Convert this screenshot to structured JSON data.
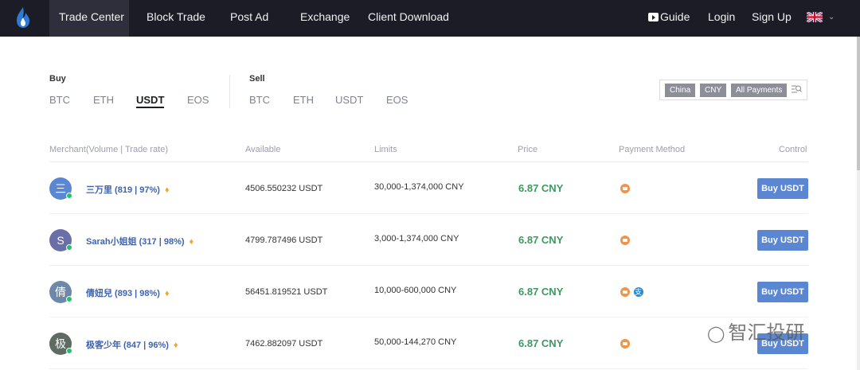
{
  "nav": {
    "logo": "flame-logo",
    "left": [
      "Trade Center",
      "Block Trade",
      "Post Ad",
      "Exchange",
      "Client Download"
    ],
    "guide": "Guide",
    "login": "Login",
    "signup": "Sign Up",
    "language": "uk-flag"
  },
  "buy": {
    "label": "Buy",
    "coins": [
      "BTC",
      "ETH",
      "USDT",
      "EOS"
    ],
    "selected": "USDT"
  },
  "sell": {
    "label": "Sell",
    "coins": [
      "BTC",
      "ETH",
      "USDT",
      "EOS"
    ]
  },
  "filters": {
    "country": "China",
    "currency": "CNY",
    "payment": "All Payments",
    "icon": "search-icon"
  },
  "table": {
    "headers": [
      "Merchant(Volume | Trade rate)",
      "Available",
      "Limits",
      "Price",
      "Payment Method",
      "Control"
    ],
    "rows": [
      {
        "avatar": "三",
        "avatar_color": "#5b86d1",
        "merchant": "三万里 (819 | 97%)",
        "available": "4506.550232 USDT",
        "limits": "30,000-1,374,000 CNY",
        "price": "6.87 CNY",
        "payments": [
          "bank"
        ],
        "button": "Buy USDT"
      },
      {
        "avatar": "S",
        "avatar_color": "#6b6fa8",
        "merchant": "Sarah小姐姐 (317 | 98%)",
        "available": "4799.787496 USDT",
        "limits": "3,000-1,374,000 CNY",
        "price": "6.87 CNY",
        "payments": [
          "bank"
        ],
        "button": "Buy USDT"
      },
      {
        "avatar": "倩",
        "avatar_color": "#6d88a9",
        "merchant": "倩妞兒 (893 | 98%)",
        "available": "56451.819521 USDT",
        "limits": "10,000-600,000 CNY",
        "price": "6.87 CNY",
        "payments": [
          "bank",
          "alipay"
        ],
        "button": "Buy USDT"
      },
      {
        "avatar": "极",
        "avatar_color": "#5d6b63",
        "merchant": "极客少年 (847 | 96%)",
        "available": "7462.882097 USDT",
        "limits": "50,000-144,270 CNY",
        "price": "6.87 CNY",
        "payments": [
          "bank"
        ],
        "button": "Buy USDT"
      }
    ]
  },
  "watermark": "智汇投研",
  "colors": {
    "topbar": "#1b1c26",
    "accent": "#5b86d1",
    "price": "#3c9a5f",
    "online": "#23c16c"
  }
}
